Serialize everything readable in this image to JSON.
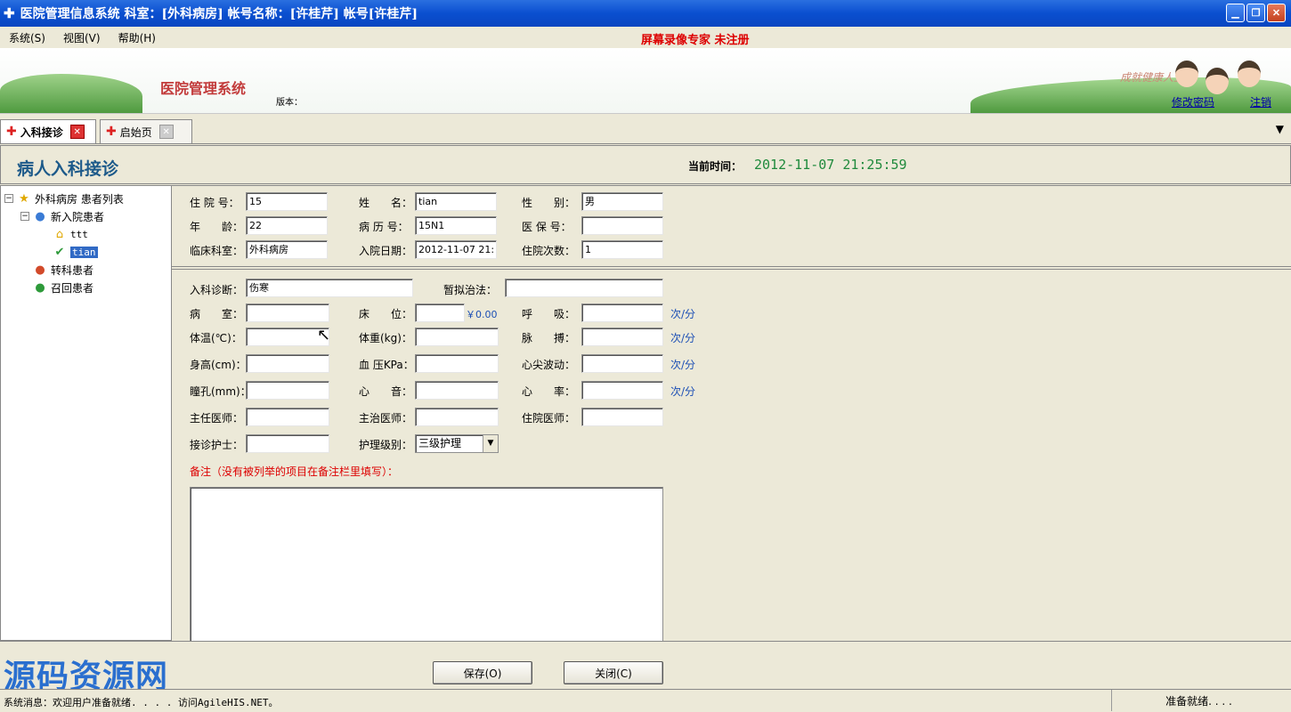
{
  "window": {
    "title": "医院管理信息系统 科室：[外科病房] 帐号名称：[许桂芹] 帐号[许桂芹]"
  },
  "menu": {
    "items": [
      "系统(S)",
      "视图(V)",
      "帮助(H)"
    ],
    "registration_note": "屏幕录像专家 未注册"
  },
  "banner": {
    "system_name": "医院管理系统",
    "version_label": "版本：",
    "slogan": "成就健康人生",
    "links": [
      "修改密码",
      "注销"
    ]
  },
  "tabs": [
    {
      "label": "入科接诊",
      "active": true
    },
    {
      "label": "启始页",
      "active": false
    }
  ],
  "header": {
    "title": "病人入科接诊",
    "time_label": "当前时间：",
    "time_value": "2012-11-07 21:25:59"
  },
  "tree": {
    "root": "外科病房 患者列表",
    "new_patients": "新入院患者",
    "patients": [
      "ttt",
      "tian"
    ],
    "transfer": "转科患者",
    "recall": "召回患者"
  },
  "form_top": {
    "inpatient_no_label": "住 院 号：",
    "inpatient_no": "15",
    "name_label": "姓　　名：",
    "name": "tian",
    "gender_label": "性　　别：",
    "gender": "男",
    "age_label": "年　　龄：",
    "age": "22",
    "record_no_label": "病 历 号：",
    "record_no": "15N1",
    "insurance_no_label": "医 保 号：",
    "insurance_no": "",
    "dept_label": "临床科室：",
    "dept": "外科病房",
    "admit_date_label": "入院日期：",
    "admit_date": "2012-11-07 21:",
    "admit_count_label": "住院次数：",
    "admit_count": "1"
  },
  "form_main": {
    "diagnosis_label": "入科诊断：",
    "diagnosis": "伤寒",
    "treatment_label": "暂拟治法：",
    "treatment": "",
    "ward_label": "病　　室：",
    "ward": "",
    "bed_label": "床　　位：",
    "bed": "",
    "bed_price": "￥0.00",
    "respiration_label": "呼　　吸：",
    "respiration": "",
    "temperature_label": "体温(℃)：",
    "temperature": "",
    "weight_label": "体重(kg)：",
    "weight": "",
    "pulse_label": "脉　　搏：",
    "pulse": "",
    "height_label": "身高(cm)：",
    "height": "",
    "bp_label": "血 压KPa：",
    "bp": "",
    "apex_label": "心尖波动：",
    "apex": "",
    "pupil_label": "瞳孔(mm)：",
    "pupil": "",
    "heart_sound_label": "心　　音：",
    "heart_sound": "",
    "heart_rate_label": "心　　率：",
    "heart_rate": "",
    "chief_doctor_label": "主任医师：",
    "chief_doctor": "",
    "attending_label": "主治医师：",
    "attending": "",
    "resident_label": "住院医师：",
    "resident": "",
    "nurse_label": "接诊护士：",
    "nurse": "",
    "care_level_label": "护理级别：",
    "care_level": "三级护理",
    "unit_per_min": "次/分",
    "remark_label": "备注（没有被列举的项目在备注栏里填写）："
  },
  "buttons": {
    "save": "保存(O)",
    "close": "关闭(C)"
  },
  "watermark": "源码资源网",
  "status": {
    "left": "系统消息：欢迎用户准备就绪. . . . 访问AgileHIS.NET。",
    "right": "准备就绪. . . ."
  }
}
